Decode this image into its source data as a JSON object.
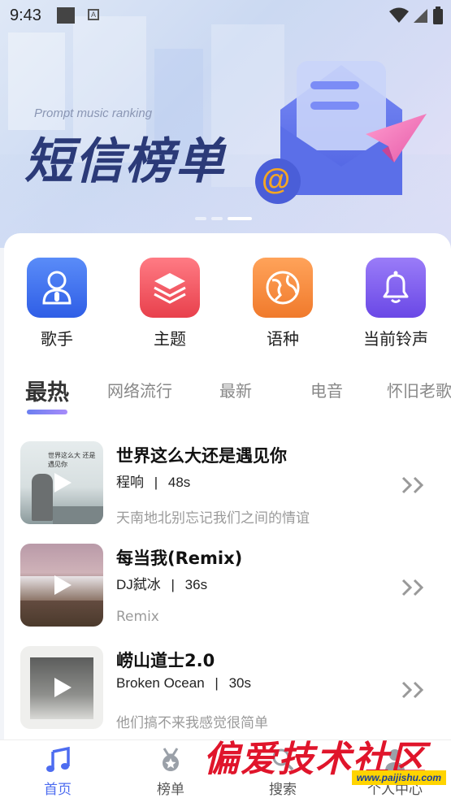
{
  "status_bar": {
    "time": "9:43",
    "notification_letter": "A"
  },
  "banner": {
    "subtitle": "Prompt music ranking",
    "headline": "短信榜单",
    "email_symbol": "@"
  },
  "categories": [
    {
      "label": "歌手",
      "icon": "singer-icon",
      "color": "#3d6ef0"
    },
    {
      "label": "主题",
      "icon": "layers-icon",
      "color": "#f0535f"
    },
    {
      "label": "语种",
      "icon": "globe-icon",
      "color": "#f5883a"
    },
    {
      "label": "当前铃声",
      "icon": "bell-icon",
      "color": "#7b5cf0"
    }
  ],
  "tabs": [
    "最热",
    "网络流行",
    "最新",
    "电音",
    "怀旧老歌"
  ],
  "active_tab": "最热",
  "songs": [
    {
      "title": "世界这么大还是遇见你",
      "artist": "程响",
      "duration": "48s",
      "desc": "天南地北别忘记我们之间的情谊",
      "cover_text": "世界这么大 还是遇见你"
    },
    {
      "title": "每当我(Remix)",
      "artist": "DJ弑冰",
      "duration": "36s",
      "desc": "Remix"
    },
    {
      "title": "崂山道士2.0",
      "artist": "Broken Ocean",
      "duration": "30s",
      "desc": "他们搞不来我感觉很简单"
    }
  ],
  "separator": "|",
  "nav": [
    {
      "label": "首页",
      "icon": "music-note-icon",
      "active": true
    },
    {
      "label": "榜单",
      "icon": "medal-icon",
      "active": false
    },
    {
      "label": "搜索",
      "icon": "search-icon",
      "active": false
    },
    {
      "label": "个人中心",
      "icon": "user-icon",
      "active": false
    }
  ],
  "watermark": {
    "text": "偏爱技术社区",
    "url": "www.paijishu.com"
  },
  "colors": {
    "accent": "#4d6cf0",
    "headline": "#2b3a78"
  }
}
